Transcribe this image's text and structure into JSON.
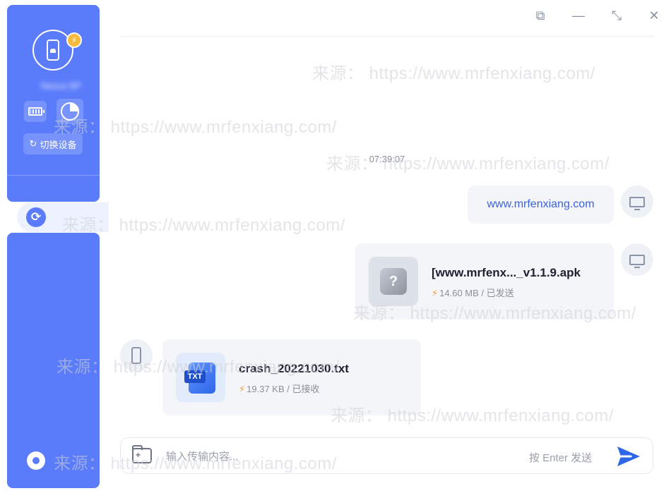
{
  "sidebar": {
    "device_name": "Nexus 6P",
    "switch_device_label": "切换设备",
    "bolt_glyph": "⚡"
  },
  "window_controls": {
    "pin": "⧉",
    "minimize": "—",
    "restore": "⤡",
    "close": "✕"
  },
  "chat": {
    "timestamp": "07:39:07",
    "messages": [
      {
        "type": "link",
        "text": "www.mrfenxiang.com",
        "sender": "computer"
      },
      {
        "type": "file",
        "name": "[www.mrfenx..._v1.1.9.apk",
        "size": "14.60 MB",
        "status": "已发送",
        "sender": "computer",
        "thumb_glyph": "?"
      },
      {
        "type": "file",
        "name": "crash_20221030.txt",
        "size": "19.37 KB",
        "status": "已接收",
        "sender": "phone",
        "thumb_label": "TXT"
      }
    ],
    "meta_separator": " / "
  },
  "input": {
    "placeholder": "输入传输内容...",
    "send_hint": "按 Enter 发送"
  },
  "watermarks": [
    "来源： https://www.mrfenxiang.com/",
    "来源： https://www.mrfenxiang.com/",
    "来源： https://www.mrfenxiang.com/",
    "来源： https://www.mrfenxiang.com/",
    "来源： https://www.mrfenxiang.com/",
    "来源： https://www.mrfenxiang.com/",
    "来源： https://www.mrfenxiang.com/",
    "来源： https://www.mrfenxiang.com/"
  ],
  "colors": {
    "sidebar": "#5b7cfa",
    "link": "#3c62d9",
    "send": "#2f66e8",
    "bolt": "#f59f3a"
  }
}
